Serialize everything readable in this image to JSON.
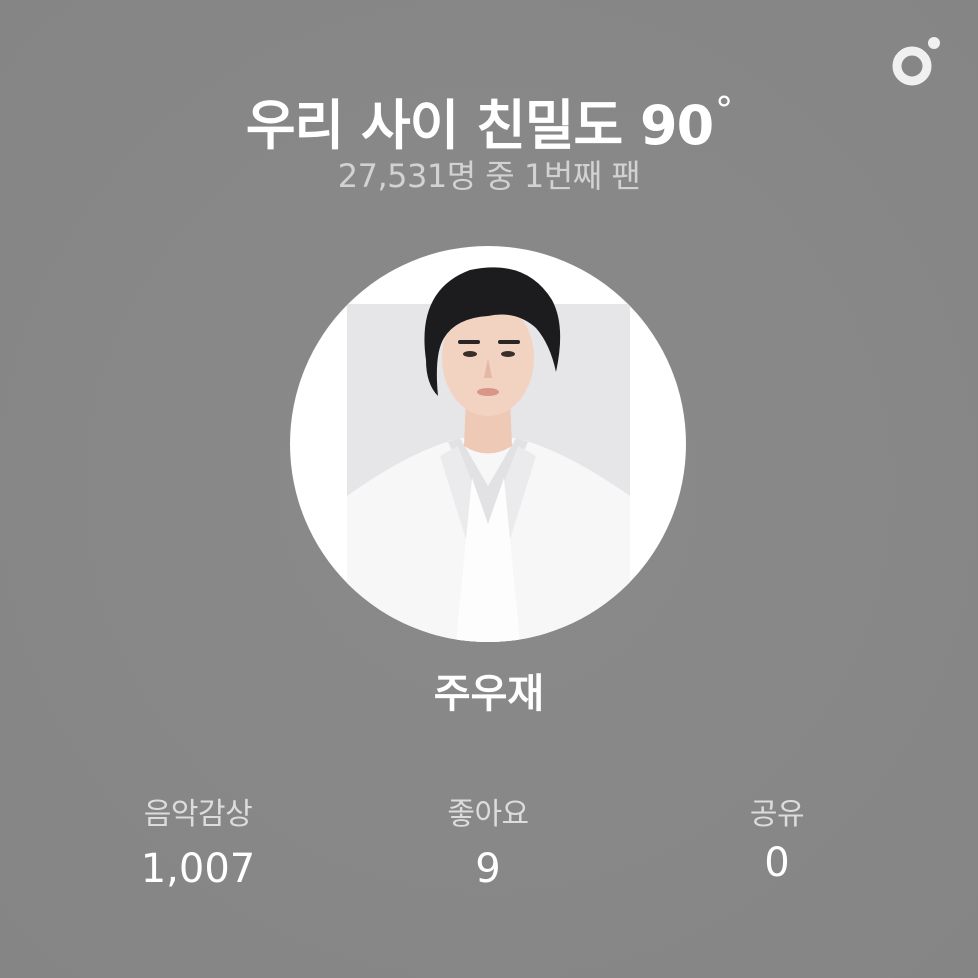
{
  "brand": {
    "logo_icon": "flo-logo-icon"
  },
  "header": {
    "title": "우리 사이 친밀도 90",
    "degree_symbol": "°",
    "subtitle": "27,531명 중 1번째 팬"
  },
  "artist": {
    "photo_icon": "artist-photo",
    "name": "주우재"
  },
  "stats": [
    {
      "label": "음악감상",
      "value": "1,007"
    },
    {
      "label": "좋아요",
      "value": "9"
    },
    {
      "label": "공유",
      "value": "0"
    }
  ],
  "colors": {
    "background": "#888888",
    "text_primary": "#ffffff",
    "text_secondary": "#d2d2d2"
  }
}
